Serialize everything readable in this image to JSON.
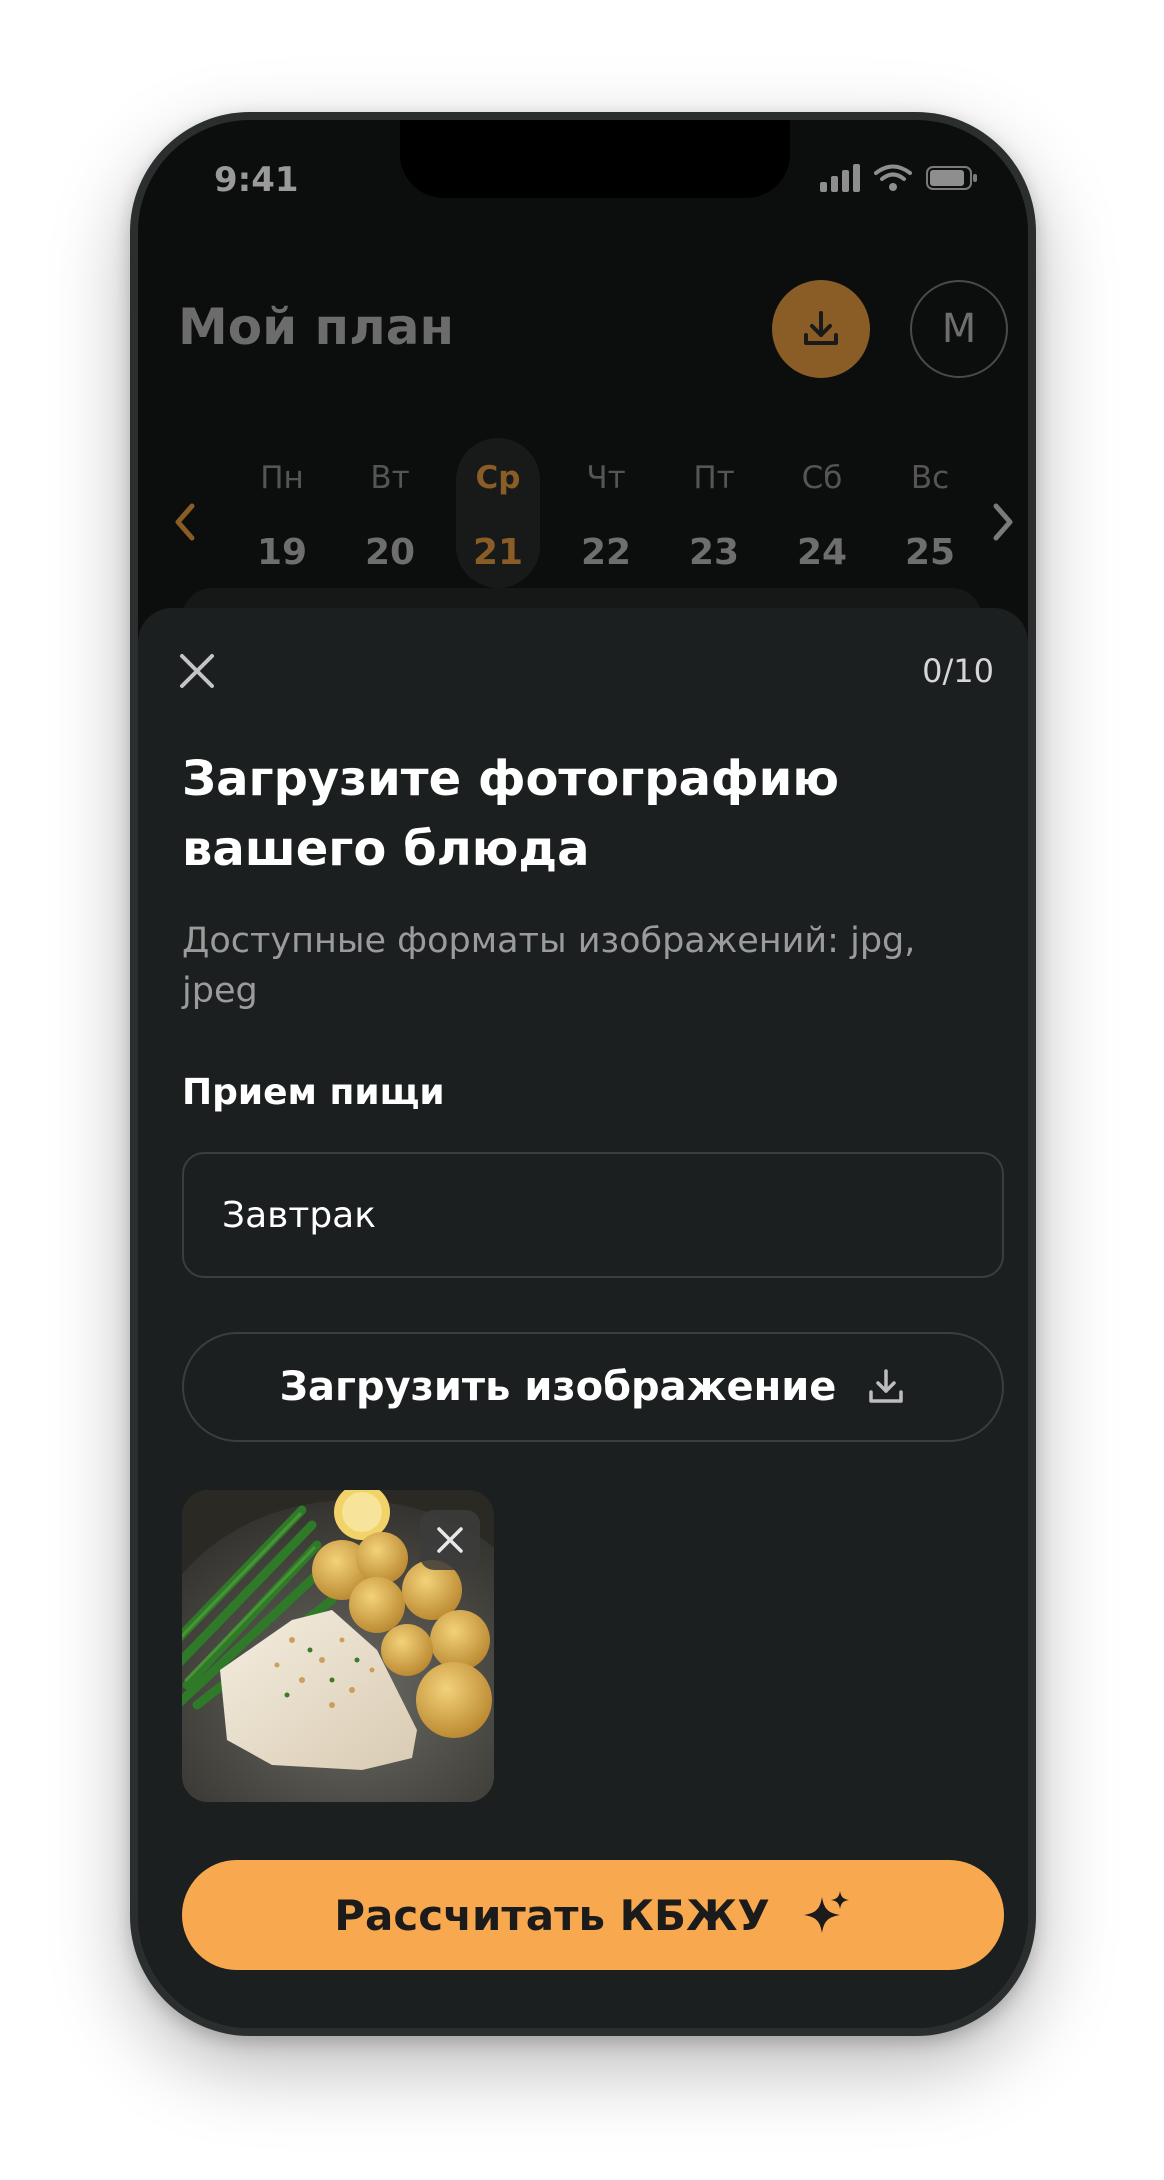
{
  "status_bar": {
    "time": "9:41"
  },
  "header": {
    "title": "Мой план",
    "avatar_initial": "M",
    "accent_color": "#8a5c26"
  },
  "week": {
    "days": [
      {
        "name": "Пн",
        "date": "19"
      },
      {
        "name": "Вт",
        "date": "20"
      },
      {
        "name": "Ср",
        "date": "21",
        "active": true
      },
      {
        "name": "Чт",
        "date": "22"
      },
      {
        "name": "Пт",
        "date": "23"
      },
      {
        "name": "Сб",
        "date": "24"
      },
      {
        "name": "Вс",
        "date": "25"
      }
    ]
  },
  "sheet": {
    "counter": "0/10",
    "title": "Загрузите фотографию вашего блюда",
    "subtitle": "Доступные форматы изображений: jpg, jpeg",
    "meal_label": "Прием пищи",
    "meal_value": "Завтрак",
    "upload_label": "Загрузить изображение",
    "calculate_label": "Рассчитать КБЖУ",
    "calculate_color": "#f8a94f"
  }
}
